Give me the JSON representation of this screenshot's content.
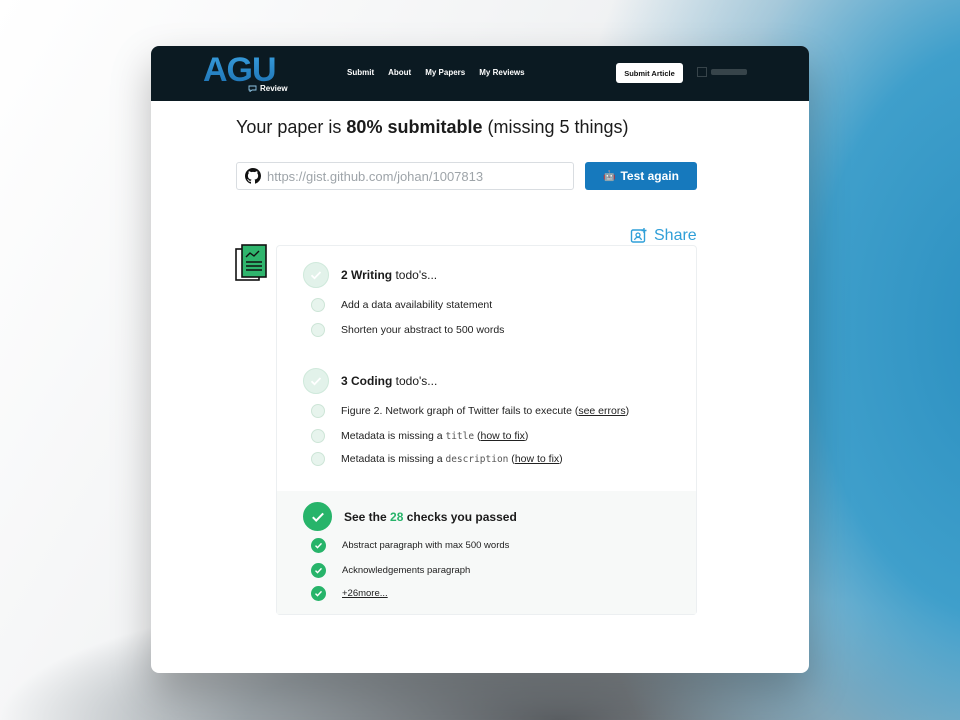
{
  "header": {
    "logo_text": "AGU",
    "logo_sub": "Review",
    "nav": [
      "Submit",
      "About",
      "My Papers",
      "My Reviews"
    ],
    "submit_button": "Submit Article"
  },
  "headline": {
    "prefix": "Your paper is ",
    "bold": "80% submitable",
    "suffix": " (missing 5 things)"
  },
  "url_input": {
    "placeholder": "https://gist.github.com/johan/1007813"
  },
  "test_button": {
    "icon": "🤖",
    "label": "Test again"
  },
  "share": {
    "label": "Share"
  },
  "writing": {
    "title_bold": "2 Writing",
    "title_rest": " todo's...",
    "items": [
      "Add a data availability statement",
      "Shorten your abstract to 500 words"
    ]
  },
  "coding": {
    "title_bold": "3 Coding",
    "title_rest": " todo's...",
    "item1_text": "Figure 2. Network graph of Twitter fails to execute (",
    "item1_link": "see errors",
    "item1_end": ")",
    "item2_text": "Metadata is missing a ",
    "item2_code": "title",
    "item2_open": " (",
    "item2_link": "how to fix",
    "item2_end": ")",
    "item3_text": "Metadata is missing a ",
    "item3_code": "description",
    "item3_open": " (",
    "item3_link": "how to fix",
    "item3_end": ")"
  },
  "passed": {
    "title_prefix": "See the ",
    "count": "28",
    "title_suffix": " checks you passed",
    "items": [
      "Abstract paragraph with max 500 words",
      "Acknowledgements paragraph"
    ],
    "more_link": "+26more..."
  },
  "colors": {
    "nav_bg": "#0b1a22",
    "accent": "#1679bd",
    "success": "#27b46a",
    "share": "#2f9fd8"
  }
}
